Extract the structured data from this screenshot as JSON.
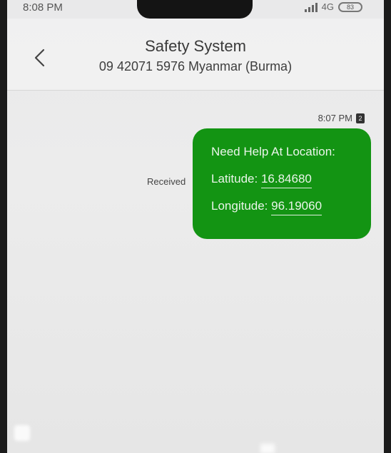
{
  "status_bar": {
    "time": "8:08 PM",
    "network": "4G",
    "battery": "83"
  },
  "header": {
    "title": "Safety System",
    "subtitle": "09 42071 5976 Myanmar (Burma)"
  },
  "message": {
    "time": "8:07 PM",
    "sim": "2",
    "status": "Received",
    "line1": "Need Help At Location:",
    "lat_label": "Latitude: ",
    "lat_value": "16.84680",
    "lon_label": "Longitude: ",
    "lon_value": "96.19060",
    "bubble_color": "#139413"
  }
}
